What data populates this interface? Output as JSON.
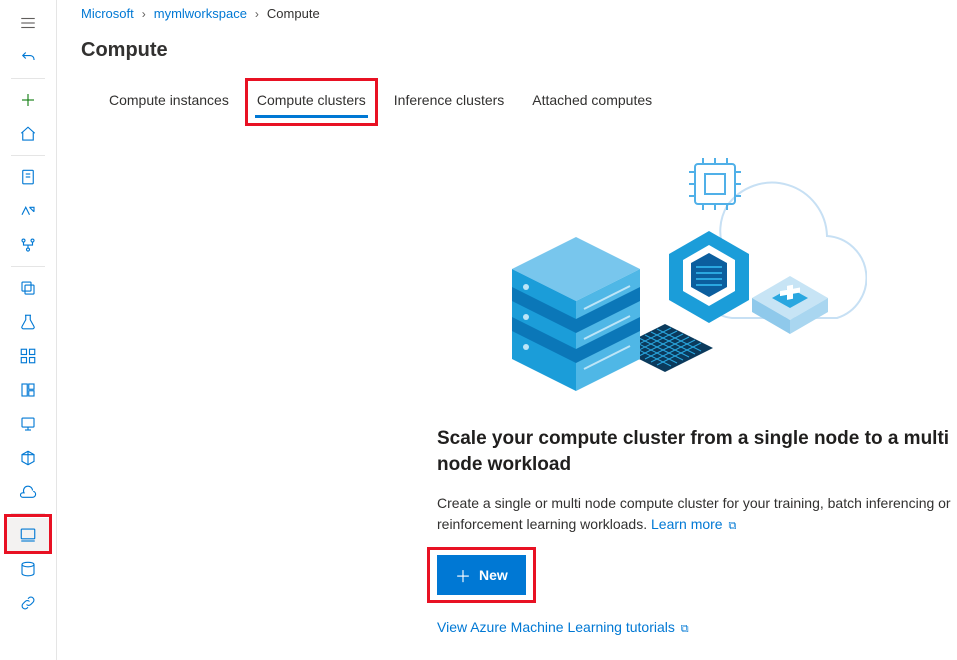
{
  "breadcrumb": {
    "items": [
      "Microsoft",
      "mymlworkspace",
      "Compute"
    ]
  },
  "page": {
    "title": "Compute"
  },
  "tabs": {
    "items": [
      {
        "label": "Compute instances"
      },
      {
        "label": "Compute clusters"
      },
      {
        "label": "Inference clusters"
      },
      {
        "label": "Attached computes"
      }
    ],
    "active_index": 1
  },
  "empty_state": {
    "title": "Scale your compute cluster from a single node to a multi node workload",
    "description": "Create a single or multi node compute cluster for your training, batch inferencing or reinforcement learning workloads.",
    "learn_more": "Learn more",
    "new_button": "New",
    "tutorial_link": "View Azure Machine Learning tutorials"
  },
  "sidebar": {
    "icons": [
      "menu-icon",
      "back-icon",
      "plus-icon",
      "home-icon",
      "notebooks-icon",
      "automl-icon",
      "designer-icon",
      "datasets-icon",
      "experiments-icon",
      "pipelines-icon",
      "models-icon",
      "endpoints-icon",
      "environments-icon",
      "datastores-icon",
      "compute-icon",
      "data-labeling-icon",
      "linked-services-icon"
    ]
  }
}
